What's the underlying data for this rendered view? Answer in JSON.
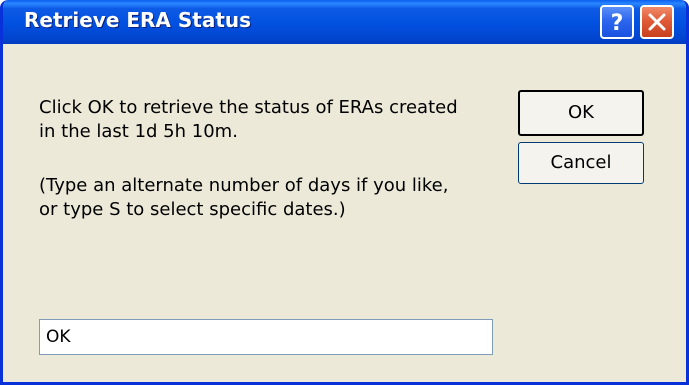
{
  "dialog": {
    "title": "Retrieve ERA Status",
    "help_glyph": "?",
    "message_line1": "Click OK to retrieve the status of ERAs created",
    "message_line2": "in the last 1d 5h 10m.",
    "message_line3": "(Type an alternate number of days if you like,",
    "message_line4": "or type S to select specific dates.)",
    "ok_label": "OK",
    "cancel_label": "Cancel",
    "input_value": "OK"
  },
  "colors": {
    "titlebar": "#0250DF",
    "body": "#ECE9D8",
    "close_button": "#E05C38",
    "help_button": "#2C66EE"
  },
  "icons": {
    "help": "help-icon",
    "close": "close-icon"
  }
}
